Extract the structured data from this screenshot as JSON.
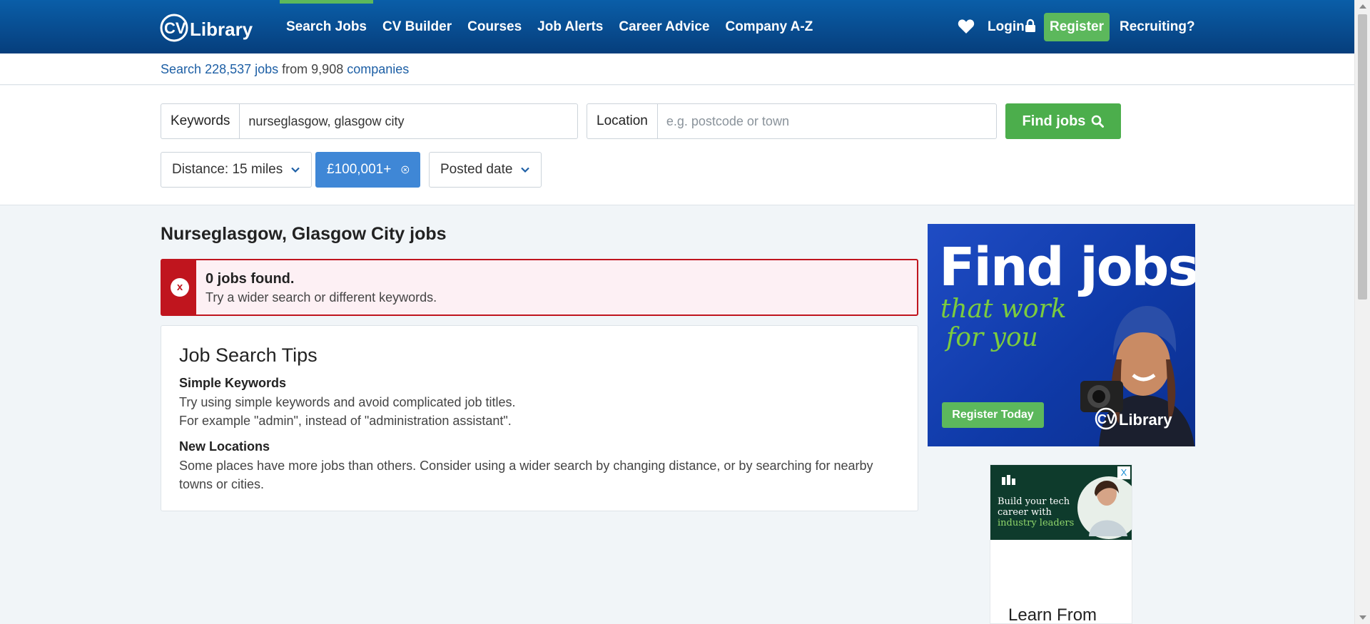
{
  "header": {
    "logo_text": "CV Library",
    "nav": [
      "Search Jobs",
      "CV Builder",
      "Courses",
      "Job Alerts",
      "Career Advice",
      "Company A-Z"
    ],
    "active_nav": "Search Jobs",
    "login": "Login",
    "register": "Register",
    "recruiting": "Recruiting?"
  },
  "stats": {
    "prefix": "Search",
    "jobs": "228,537 jobs",
    "middle": "from 9,908",
    "companies": "companies"
  },
  "search": {
    "keywords_label": "Keywords",
    "keywords_value": "nurseglasgow, glasgow city",
    "location_label": "Location",
    "location_placeholder": "e.g. postcode or town",
    "find_button": "Find jobs"
  },
  "filters": {
    "distance": "Distance: 15 miles",
    "salary": "£100,001+",
    "posted": "Posted date"
  },
  "results": {
    "title": "Nurseglasgow, Glasgow City jobs",
    "alert_icon": "x",
    "alert_title": "0 jobs found.",
    "alert_sub": "Try a wider search or different keywords."
  },
  "tips": {
    "heading": "Job Search Tips",
    "items": [
      {
        "title": "Simple Keywords",
        "lines": [
          "Try using simple keywords and avoid complicated job titles.",
          "For example \"admin\", instead of \"administration assistant\"."
        ]
      },
      {
        "title": "New Locations",
        "lines": [
          "Some places have more jobs than others. Consider using a wider search by changing distance, or by searching for nearby towns or cities."
        ]
      }
    ]
  },
  "ads": {
    "ad1_headline": "Find jobs",
    "ad1_sub_line1": "that work",
    "ad1_sub_line2": "for you",
    "ad1_button": "Register Today",
    "ad1_logo": "CV Library",
    "ad2_line1": "Build your tech",
    "ad2_line2": "career with",
    "ad2_line3": "industry leaders",
    "ad2_bottom": "Learn From",
    "ad2_close": "X"
  },
  "colors": {
    "header_blue": "#063e7c",
    "accent_green": "#5cb85c",
    "link_blue": "#1d5fa5",
    "error_red": "#c0151e",
    "filter_active": "#3f87d6"
  }
}
